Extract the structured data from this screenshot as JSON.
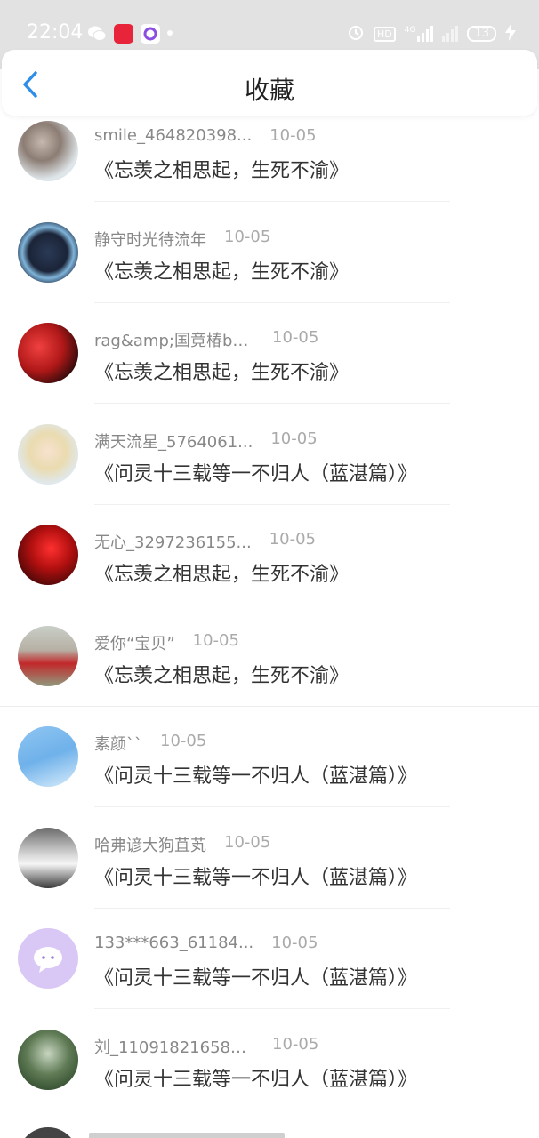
{
  "status": {
    "time": "22:04",
    "signal": "4G",
    "battery": "13"
  },
  "header": {
    "title": "收藏"
  },
  "colors": {
    "accent": "#2e8ee8",
    "status_bg": "#e2e2e2"
  },
  "favorites": [
    {
      "user": "smile_464820398...",
      "date": "10-05",
      "book": "《忘羡之相思起，生死不渝》"
    },
    {
      "user": "静守时光待流年",
      "date": "10-05",
      "book": "《忘羡之相思起，生死不渝》"
    },
    {
      "user": "rag&amp;国竟椿bo...",
      "date": "10-05",
      "book": "《忘羡之相思起，生死不渝》"
    },
    {
      "user": "满天流星_5764061...",
      "date": "10-05",
      "book": "《问灵十三载等一不归人（蓝湛篇）》"
    },
    {
      "user": "无心_3297236155...",
      "date": "10-05",
      "book": "《忘羡之相思起，生死不渝》"
    },
    {
      "user": "爱你“宝贝”",
      "date": "10-05",
      "book": "《忘羡之相思起，生死不渝》"
    },
    {
      "user": "素颜``",
      "date": "10-05",
      "book": "《问灵十三载等一不归人（蓝湛篇）》"
    },
    {
      "user": "哈弗谚大狗苴芄",
      "date": "10-05",
      "book": "《问灵十三载等一不归人（蓝湛篇）》"
    },
    {
      "user": "133***663_61184...",
      "date": "10-05",
      "book": "《问灵十三载等一不归人（蓝湛篇）》"
    },
    {
      "user": "刘_110918216583...",
      "date": "10-05",
      "book": "《问灵十三载等一不归人（蓝湛篇）》"
    }
  ]
}
